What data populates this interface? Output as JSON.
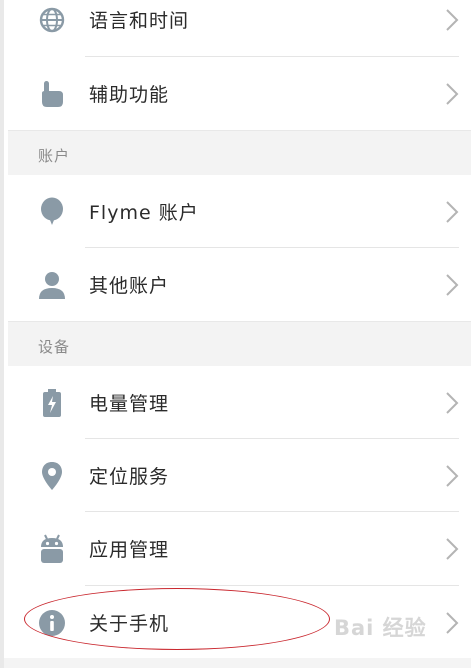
{
  "settings": {
    "rows": [
      {
        "label": "语言和时间",
        "icon": "globe-icon"
      },
      {
        "label": "辅助功能",
        "icon": "hand-pointer-icon"
      },
      {
        "label": "Flyme 账户",
        "icon": "balloon-icon"
      },
      {
        "label": "其他账户",
        "icon": "person-icon"
      },
      {
        "label": "电量管理",
        "icon": "battery-icon"
      },
      {
        "label": "定位服务",
        "icon": "location-pin-icon"
      },
      {
        "label": "应用管理",
        "icon": "android-icon"
      },
      {
        "label": "关于手机",
        "icon": "info-icon"
      }
    ],
    "sections": {
      "account": "账户",
      "device": "设备"
    }
  },
  "watermark": {
    "text": "Bai 经验"
  },
  "colors": {
    "icon": "#8a9aa6",
    "text": "#2b2b2b",
    "section_bg": "#f3f3f3",
    "annotation": "#c9272e"
  }
}
